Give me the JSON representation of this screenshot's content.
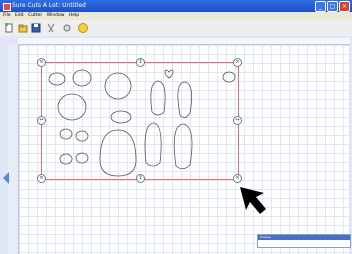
{
  "window": {
    "title": "Sure Cuts A Lot: Untitled"
  },
  "menu": [
    "File",
    "Edit",
    "Cutter",
    "Window",
    "Help"
  ],
  "toolbar": {
    "items": [
      "new-icon",
      "open-icon",
      "save-icon",
      "cut-icon",
      "star-icon",
      "help-icon"
    ]
  },
  "panel": {
    "title": "Shapes"
  },
  "colors": {
    "selection": "#e07070",
    "accent": "#2f6fe0"
  }
}
